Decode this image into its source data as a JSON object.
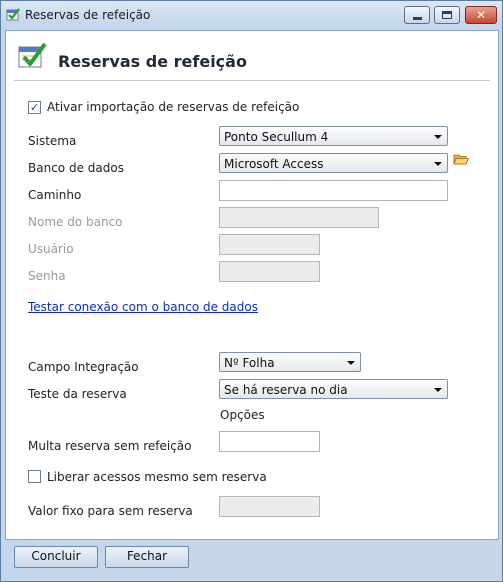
{
  "window": {
    "title": "Reservas de refeição"
  },
  "header": {
    "title": "Reservas de refeição"
  },
  "form": {
    "ativar_importacao": {
      "label": "Ativar importação de reservas de refeição",
      "checked": true
    },
    "sistema": {
      "label": "Sistema",
      "value": "Ponto Secullum 4"
    },
    "banco_de_dados": {
      "label": "Banco de dados",
      "value": "Microsoft Access"
    },
    "caminho": {
      "label": "Caminho",
      "value": ""
    },
    "nome_do_banco": {
      "label": "Nome do banco",
      "value": ""
    },
    "usuario": {
      "label": "Usuário",
      "value": ""
    },
    "senha": {
      "label": "Senha",
      "value": ""
    },
    "testar_conexao": "Testar conexão com o banco de dados",
    "campo_integracao": {
      "label": "Campo Integração",
      "value": "Nº Folha"
    },
    "teste_da_reserva": {
      "label": "Teste da reserva",
      "value": "Se há reserva no dia"
    },
    "opcoes_label": "Opções",
    "multa_reserva": {
      "label": "Multa reserva sem refeição",
      "value": ""
    },
    "liberar_acessos": {
      "label": "Liberar acessos mesmo sem reserva",
      "checked": false
    },
    "valor_fixo": {
      "label": "Valor fixo para sem reserva",
      "value": ""
    }
  },
  "buttons": {
    "concluir": "Concluir",
    "fechar": "Fechar"
  },
  "icons": {
    "title": "meal-reservation-icon",
    "header": "meal-reservation-icon",
    "folder": "folder-open-icon"
  },
  "colors": {
    "link": "#0a2ebf",
    "frame": "#c5d6ea"
  }
}
